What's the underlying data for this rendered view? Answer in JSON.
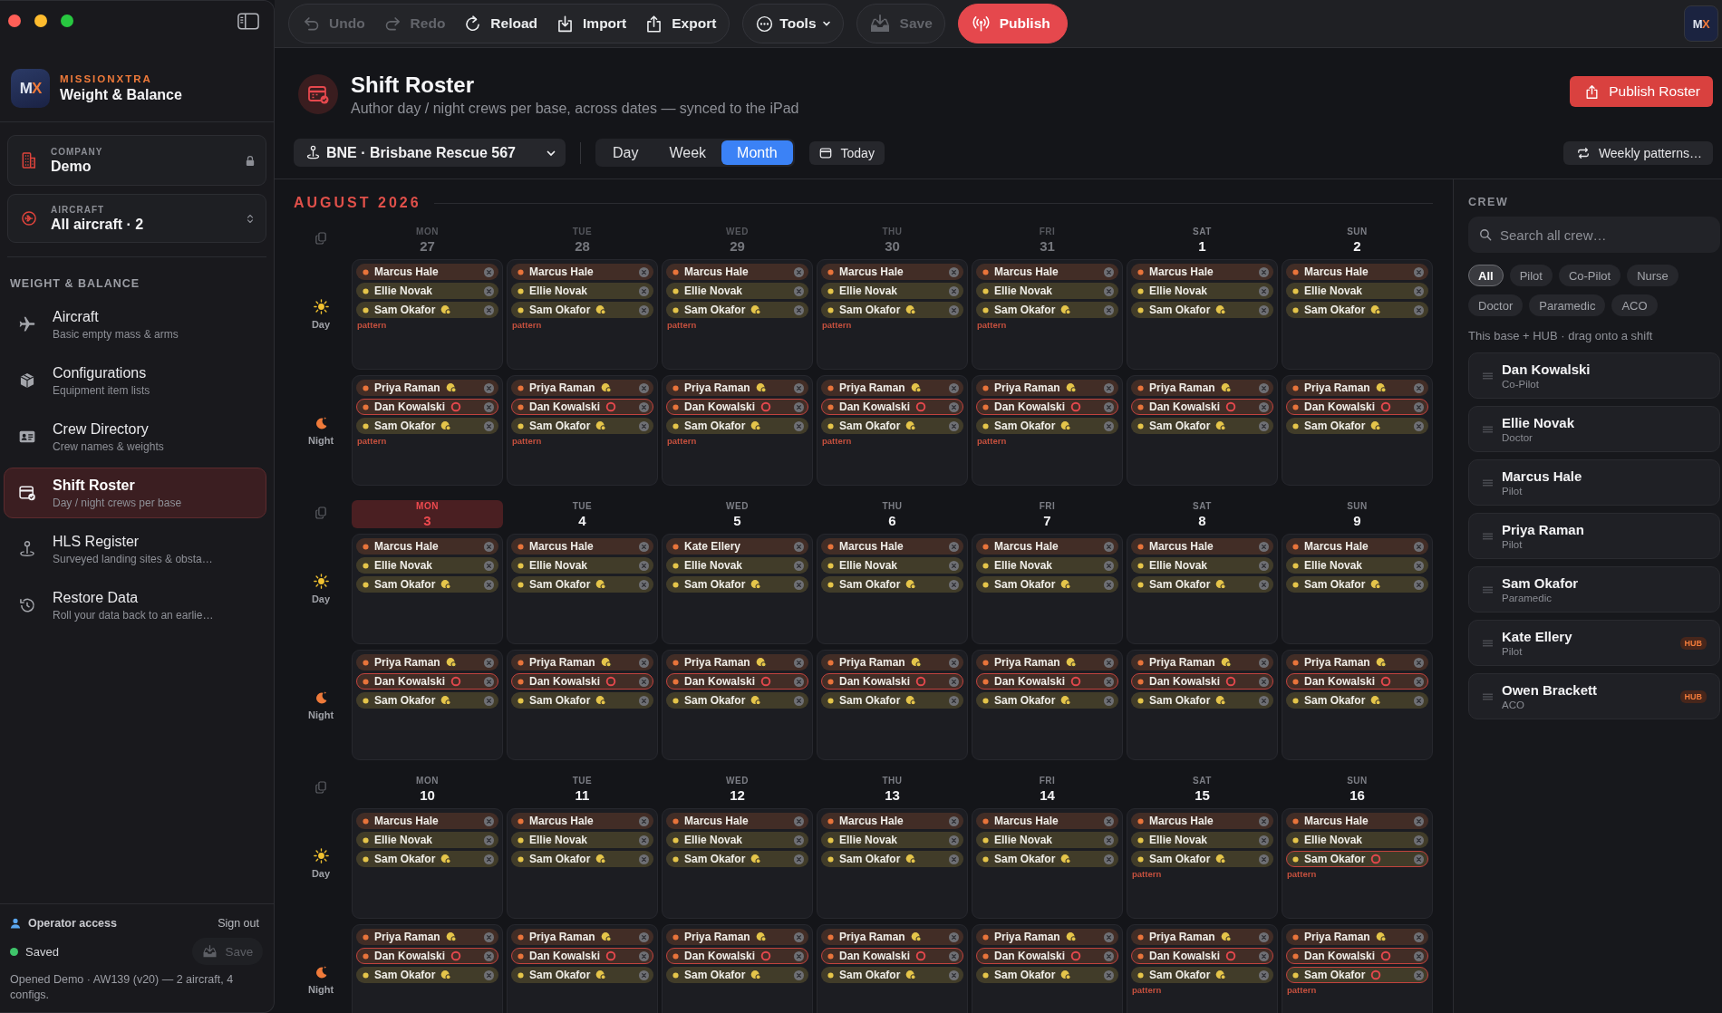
{
  "sidebar": {
    "brand": {
      "logo": "MX",
      "name": "MISSIONXTRA",
      "product": "Weight & Balance"
    },
    "company": {
      "label": "COMPANY",
      "value": "Demo",
      "locked": true
    },
    "aircraft": {
      "label": "AIRCRAFT",
      "value": "All aircraft · 2"
    },
    "section": "WEIGHT & BALANCE",
    "nav": [
      {
        "kind": "plane",
        "title": "Aircraft",
        "subtitle": "Basic empty mass & arms",
        "selected": false
      },
      {
        "kind": "box",
        "title": "Configurations",
        "subtitle": "Equipment item lists",
        "selected": false
      },
      {
        "kind": "card",
        "title": "Crew Directory",
        "subtitle": "Crew names & weights",
        "selected": false
      },
      {
        "kind": "calendar",
        "title": "Shift Roster",
        "subtitle": "Day / night crews per base",
        "selected": true
      },
      {
        "kind": "pin",
        "title": "HLS Register",
        "subtitle": "Surveyed landing sites & obsta…",
        "selected": false
      },
      {
        "kind": "history",
        "title": "Restore Data",
        "subtitle": "Roll your data back to an earlie…",
        "selected": false
      }
    ],
    "footer": {
      "access": "Operator access",
      "sign_out": "Sign out",
      "status": "Saved",
      "save": {
        "label": "Save",
        "disabled": true
      },
      "info": "Opened Demo · AW139 (v20) — 2 aircraft, 4 configs."
    }
  },
  "toolbar": {
    "history": [
      {
        "kind": "undo",
        "label": "Undo",
        "disabled": true
      },
      {
        "kind": "redo",
        "label": "Redo",
        "disabled": true
      },
      {
        "kind": "reload",
        "label": "Reload",
        "disabled": false
      },
      {
        "kind": "import",
        "label": "Import",
        "disabled": false
      },
      {
        "kind": "export",
        "label": "Export",
        "disabled": false
      }
    ],
    "tools": {
      "label": "Tools"
    },
    "save": {
      "label": "Save",
      "disabled": true
    },
    "publish": {
      "label": "Publish"
    },
    "avatar": "MX"
  },
  "header": {
    "title": "Shift Roster",
    "subtitle": "Author day / night crews per base, across dates — synced to the iPad",
    "action": "Publish Roster"
  },
  "controls": {
    "base": "BNE · Brisbane Rescue 567",
    "views": [
      {
        "label": "Day",
        "selected": false
      },
      {
        "label": "Week",
        "selected": false
      },
      {
        "label": "Month",
        "selected": true
      }
    ],
    "today": "Today",
    "patterns": "Weekly patterns…"
  },
  "calendar": {
    "month": "AUGUST 2026",
    "weeks": [
      {
        "days": [
          {
            "dow": "MON",
            "date": "27",
            "outside": true,
            "today": false
          },
          {
            "dow": "TUE",
            "date": "28",
            "outside": true,
            "today": false
          },
          {
            "dow": "WED",
            "date": "29",
            "outside": true,
            "today": false
          },
          {
            "dow": "THU",
            "date": "30",
            "outside": true,
            "today": false
          },
          {
            "dow": "FRI",
            "date": "31",
            "outside": true,
            "today": false
          },
          {
            "dow": "SAT",
            "date": "1",
            "outside": false,
            "today": false
          },
          {
            "dow": "SUN",
            "date": "2",
            "outside": false,
            "today": false
          }
        ],
        "shifts": [
          {
            "kind": "day",
            "label": "Day",
            "cells": [
              {
                "crew": [
                  {
                    "name": "Marcus Hale",
                    "color": "#e8743b",
                    "kind": "plain"
                  },
                  {
                    "name": "Ellie Novak",
                    "color": "#e5c54a",
                    "kind": "plain"
                  },
                  {
                    "name": "Sam Okafor",
                    "color": "#e5c54a",
                    "kind": "badge"
                  }
                ],
                "note": "pattern"
              },
              {
                "crew": [
                  {
                    "name": "Marcus Hale",
                    "color": "#e8743b",
                    "kind": "plain"
                  },
                  {
                    "name": "Ellie Novak",
                    "color": "#e5c54a",
                    "kind": "plain"
                  },
                  {
                    "name": "Sam Okafor",
                    "color": "#e5c54a",
                    "kind": "badge"
                  }
                ],
                "note": "pattern"
              },
              {
                "crew": [
                  {
                    "name": "Marcus Hale",
                    "color": "#e8743b",
                    "kind": "plain"
                  },
                  {
                    "name": "Ellie Novak",
                    "color": "#e5c54a",
                    "kind": "plain"
                  },
                  {
                    "name": "Sam Okafor",
                    "color": "#e5c54a",
                    "kind": "badge"
                  }
                ],
                "note": "pattern"
              },
              {
                "crew": [
                  {
                    "name": "Marcus Hale",
                    "color": "#e8743b",
                    "kind": "plain"
                  },
                  {
                    "name": "Ellie Novak",
                    "color": "#e5c54a",
                    "kind": "plain"
                  },
                  {
                    "name": "Sam Okafor",
                    "color": "#e5c54a",
                    "kind": "badge"
                  }
                ],
                "note": "pattern"
              },
              {
                "crew": [
                  {
                    "name": "Marcus Hale",
                    "color": "#e8743b",
                    "kind": "plain"
                  },
                  {
                    "name": "Ellie Novak",
                    "color": "#e5c54a",
                    "kind": "plain"
                  },
                  {
                    "name": "Sam Okafor",
                    "color": "#e5c54a",
                    "kind": "badge"
                  }
                ],
                "note": "pattern"
              },
              {
                "crew": [
                  {
                    "name": "Marcus Hale",
                    "color": "#e8743b",
                    "kind": "plain"
                  },
                  {
                    "name": "Ellie Novak",
                    "color": "#e5c54a",
                    "kind": "plain"
                  },
                  {
                    "name": "Sam Okafor",
                    "color": "#e5c54a",
                    "kind": "badge"
                  }
                ]
              },
              {
                "crew": [
                  {
                    "name": "Marcus Hale",
                    "color": "#e8743b",
                    "kind": "plain"
                  },
                  {
                    "name": "Ellie Novak",
                    "color": "#e5c54a",
                    "kind": "plain"
                  },
                  {
                    "name": "Sam Okafor",
                    "color": "#e5c54a",
                    "kind": "badge"
                  }
                ]
              }
            ]
          },
          {
            "kind": "night",
            "label": "Night",
            "cells": [
              {
                "crew": [
                  {
                    "name": "Priya Raman",
                    "color": "#e8743b",
                    "kind": "badge"
                  },
                  {
                    "name": "Dan Kowalski",
                    "color": "#e8743b",
                    "kind": "conflict"
                  },
                  {
                    "name": "Sam Okafor",
                    "color": "#e5c54a",
                    "kind": "badge"
                  }
                ],
                "note": "pattern"
              },
              {
                "crew": [
                  {
                    "name": "Priya Raman",
                    "color": "#e8743b",
                    "kind": "badge"
                  },
                  {
                    "name": "Dan Kowalski",
                    "color": "#e8743b",
                    "kind": "conflict"
                  },
                  {
                    "name": "Sam Okafor",
                    "color": "#e5c54a",
                    "kind": "badge"
                  }
                ],
                "note": "pattern"
              },
              {
                "crew": [
                  {
                    "name": "Priya Raman",
                    "color": "#e8743b",
                    "kind": "badge"
                  },
                  {
                    "name": "Dan Kowalski",
                    "color": "#e8743b",
                    "kind": "conflict"
                  },
                  {
                    "name": "Sam Okafor",
                    "color": "#e5c54a",
                    "kind": "badge"
                  }
                ],
                "note": "pattern"
              },
              {
                "crew": [
                  {
                    "name": "Priya Raman",
                    "color": "#e8743b",
                    "kind": "badge"
                  },
                  {
                    "name": "Dan Kowalski",
                    "color": "#e8743b",
                    "kind": "conflict"
                  },
                  {
                    "name": "Sam Okafor",
                    "color": "#e5c54a",
                    "kind": "badge"
                  }
                ],
                "note": "pattern"
              },
              {
                "crew": [
                  {
                    "name": "Priya Raman",
                    "color": "#e8743b",
                    "kind": "badge"
                  },
                  {
                    "name": "Dan Kowalski",
                    "color": "#e8743b",
                    "kind": "conflict"
                  },
                  {
                    "name": "Sam Okafor",
                    "color": "#e5c54a",
                    "kind": "badge"
                  }
                ],
                "note": "pattern"
              },
              {
                "crew": [
                  {
                    "name": "Priya Raman",
                    "color": "#e8743b",
                    "kind": "badge"
                  },
                  {
                    "name": "Dan Kowalski",
                    "color": "#e8743b",
                    "kind": "conflict"
                  },
                  {
                    "name": "Sam Okafor",
                    "color": "#e5c54a",
                    "kind": "badge"
                  }
                ]
              },
              {
                "crew": [
                  {
                    "name": "Priya Raman",
                    "color": "#e8743b",
                    "kind": "badge"
                  },
                  {
                    "name": "Dan Kowalski",
                    "color": "#e8743b",
                    "kind": "conflict"
                  },
                  {
                    "name": "Sam Okafor",
                    "color": "#e5c54a",
                    "kind": "badge"
                  }
                ]
              }
            ]
          }
        ]
      },
      {
        "days": [
          {
            "dow": "MON",
            "date": "3",
            "outside": false,
            "today": true
          },
          {
            "dow": "TUE",
            "date": "4",
            "outside": false,
            "today": false
          },
          {
            "dow": "WED",
            "date": "5",
            "outside": false,
            "today": false
          },
          {
            "dow": "THU",
            "date": "6",
            "outside": false,
            "today": false
          },
          {
            "dow": "FRI",
            "date": "7",
            "outside": false,
            "today": false
          },
          {
            "dow": "SAT",
            "date": "8",
            "outside": false,
            "today": false
          },
          {
            "dow": "SUN",
            "date": "9",
            "outside": false,
            "today": false
          }
        ],
        "shifts": [
          {
            "kind": "day",
            "label": "Day",
            "cells": [
              {
                "crew": [
                  {
                    "name": "Marcus Hale",
                    "color": "#e8743b",
                    "kind": "plain"
                  },
                  {
                    "name": "Ellie Novak",
                    "color": "#e5c54a",
                    "kind": "plain"
                  },
                  {
                    "name": "Sam Okafor",
                    "color": "#e5c54a",
                    "kind": "badge"
                  }
                ]
              },
              {
                "crew": [
                  {
                    "name": "Marcus Hale",
                    "color": "#e8743b",
                    "kind": "plain"
                  },
                  {
                    "name": "Ellie Novak",
                    "color": "#e5c54a",
                    "kind": "plain"
                  },
                  {
                    "name": "Sam Okafor",
                    "color": "#e5c54a",
                    "kind": "badge"
                  }
                ]
              },
              {
                "crew": [
                  {
                    "name": "Kate Ellery",
                    "color": "#e8743b",
                    "kind": "plain"
                  },
                  {
                    "name": "Ellie Novak",
                    "color": "#e5c54a",
                    "kind": "plain"
                  },
                  {
                    "name": "Sam Okafor",
                    "color": "#e5c54a",
                    "kind": "badge"
                  }
                ]
              },
              {
                "crew": [
                  {
                    "name": "Marcus Hale",
                    "color": "#e8743b",
                    "kind": "plain"
                  },
                  {
                    "name": "Ellie Novak",
                    "color": "#e5c54a",
                    "kind": "plain"
                  },
                  {
                    "name": "Sam Okafor",
                    "color": "#e5c54a",
                    "kind": "badge"
                  }
                ]
              },
              {
                "crew": [
                  {
                    "name": "Marcus Hale",
                    "color": "#e8743b",
                    "kind": "plain"
                  },
                  {
                    "name": "Ellie Novak",
                    "color": "#e5c54a",
                    "kind": "plain"
                  },
                  {
                    "name": "Sam Okafor",
                    "color": "#e5c54a",
                    "kind": "badge"
                  }
                ]
              },
              {
                "crew": [
                  {
                    "name": "Marcus Hale",
                    "color": "#e8743b",
                    "kind": "plain"
                  },
                  {
                    "name": "Ellie Novak",
                    "color": "#e5c54a",
                    "kind": "plain"
                  },
                  {
                    "name": "Sam Okafor",
                    "color": "#e5c54a",
                    "kind": "badge"
                  }
                ]
              },
              {
                "crew": [
                  {
                    "name": "Marcus Hale",
                    "color": "#e8743b",
                    "kind": "plain"
                  },
                  {
                    "name": "Ellie Novak",
                    "color": "#e5c54a",
                    "kind": "plain"
                  },
                  {
                    "name": "Sam Okafor",
                    "color": "#e5c54a",
                    "kind": "badge"
                  }
                ]
              }
            ]
          },
          {
            "kind": "night",
            "label": "Night",
            "cells": [
              {
                "crew": [
                  {
                    "name": "Priya Raman",
                    "color": "#e8743b",
                    "kind": "badge"
                  },
                  {
                    "name": "Dan Kowalski",
                    "color": "#e8743b",
                    "kind": "conflict"
                  },
                  {
                    "name": "Sam Okafor",
                    "color": "#e5c54a",
                    "kind": "badge"
                  }
                ]
              },
              {
                "crew": [
                  {
                    "name": "Priya Raman",
                    "color": "#e8743b",
                    "kind": "badge"
                  },
                  {
                    "name": "Dan Kowalski",
                    "color": "#e8743b",
                    "kind": "conflict"
                  },
                  {
                    "name": "Sam Okafor",
                    "color": "#e5c54a",
                    "kind": "badge"
                  }
                ]
              },
              {
                "crew": [
                  {
                    "name": "Priya Raman",
                    "color": "#e8743b",
                    "kind": "badge"
                  },
                  {
                    "name": "Dan Kowalski",
                    "color": "#e8743b",
                    "kind": "conflict"
                  },
                  {
                    "name": "Sam Okafor",
                    "color": "#e5c54a",
                    "kind": "badge"
                  }
                ]
              },
              {
                "crew": [
                  {
                    "name": "Priya Raman",
                    "color": "#e8743b",
                    "kind": "badge"
                  },
                  {
                    "name": "Dan Kowalski",
                    "color": "#e8743b",
                    "kind": "conflict"
                  },
                  {
                    "name": "Sam Okafor",
                    "color": "#e5c54a",
                    "kind": "badge"
                  }
                ]
              },
              {
                "crew": [
                  {
                    "name": "Priya Raman",
                    "color": "#e8743b",
                    "kind": "badge"
                  },
                  {
                    "name": "Dan Kowalski",
                    "color": "#e8743b",
                    "kind": "conflict"
                  },
                  {
                    "name": "Sam Okafor",
                    "color": "#e5c54a",
                    "kind": "badge"
                  }
                ]
              },
              {
                "crew": [
                  {
                    "name": "Priya Raman",
                    "color": "#e8743b",
                    "kind": "badge"
                  },
                  {
                    "name": "Dan Kowalski",
                    "color": "#e8743b",
                    "kind": "conflict"
                  },
                  {
                    "name": "Sam Okafor",
                    "color": "#e5c54a",
                    "kind": "badge"
                  }
                ]
              },
              {
                "crew": [
                  {
                    "name": "Priya Raman",
                    "color": "#e8743b",
                    "kind": "badge"
                  },
                  {
                    "name": "Dan Kowalski",
                    "color": "#e8743b",
                    "kind": "conflict"
                  },
                  {
                    "name": "Sam Okafor",
                    "color": "#e5c54a",
                    "kind": "badge"
                  }
                ]
              }
            ]
          }
        ]
      },
      {
        "days": [
          {
            "dow": "MON",
            "date": "10",
            "outside": false,
            "today": false
          },
          {
            "dow": "TUE",
            "date": "11",
            "outside": false,
            "today": false
          },
          {
            "dow": "WED",
            "date": "12",
            "outside": false,
            "today": false
          },
          {
            "dow": "THU",
            "date": "13",
            "outside": false,
            "today": false
          },
          {
            "dow": "FRI",
            "date": "14",
            "outside": false,
            "today": false
          },
          {
            "dow": "SAT",
            "date": "15",
            "outside": false,
            "today": false
          },
          {
            "dow": "SUN",
            "date": "16",
            "outside": false,
            "today": false
          }
        ],
        "shifts": [
          {
            "kind": "day",
            "label": "Day",
            "cells": [
              {
                "crew": [
                  {
                    "name": "Marcus Hale",
                    "color": "#e8743b",
                    "kind": "plain"
                  },
                  {
                    "name": "Ellie Novak",
                    "color": "#e5c54a",
                    "kind": "plain"
                  },
                  {
                    "name": "Sam Okafor",
                    "color": "#e5c54a",
                    "kind": "badge"
                  }
                ]
              },
              {
                "crew": [
                  {
                    "name": "Marcus Hale",
                    "color": "#e8743b",
                    "kind": "plain"
                  },
                  {
                    "name": "Ellie Novak",
                    "color": "#e5c54a",
                    "kind": "plain"
                  },
                  {
                    "name": "Sam Okafor",
                    "color": "#e5c54a",
                    "kind": "badge"
                  }
                ]
              },
              {
                "crew": [
                  {
                    "name": "Marcus Hale",
                    "color": "#e8743b",
                    "kind": "plain"
                  },
                  {
                    "name": "Ellie Novak",
                    "color": "#e5c54a",
                    "kind": "plain"
                  },
                  {
                    "name": "Sam Okafor",
                    "color": "#e5c54a",
                    "kind": "badge"
                  }
                ]
              },
              {
                "crew": [
                  {
                    "name": "Marcus Hale",
                    "color": "#e8743b",
                    "kind": "plain"
                  },
                  {
                    "name": "Ellie Novak",
                    "color": "#e5c54a",
                    "kind": "plain"
                  },
                  {
                    "name": "Sam Okafor",
                    "color": "#e5c54a",
                    "kind": "badge"
                  }
                ]
              },
              {
                "crew": [
                  {
                    "name": "Marcus Hale",
                    "color": "#e8743b",
                    "kind": "plain"
                  },
                  {
                    "name": "Ellie Novak",
                    "color": "#e5c54a",
                    "kind": "plain"
                  },
                  {
                    "name": "Sam Okafor",
                    "color": "#e5c54a",
                    "kind": "badge"
                  }
                ]
              },
              {
                "crew": [
                  {
                    "name": "Marcus Hale",
                    "color": "#e8743b",
                    "kind": "plain"
                  },
                  {
                    "name": "Ellie Novak",
                    "color": "#e5c54a",
                    "kind": "plain"
                  },
                  {
                    "name": "Sam Okafor",
                    "color": "#e5c54a",
                    "kind": "badge"
                  }
                ],
                "note": "pattern"
              },
              {
                "crew": [
                  {
                    "name": "Marcus Hale",
                    "color": "#e8743b",
                    "kind": "plain"
                  },
                  {
                    "name": "Ellie Novak",
                    "color": "#e5c54a",
                    "kind": "plain"
                  },
                  {
                    "name": "Sam Okafor",
                    "color": "#e5c54a",
                    "kind": "conflict"
                  }
                ],
                "note": "pattern"
              }
            ]
          },
          {
            "kind": "night",
            "label": "Night",
            "cells": [
              {
                "crew": [
                  {
                    "name": "Priya Raman",
                    "color": "#e8743b",
                    "kind": "badge"
                  },
                  {
                    "name": "Dan Kowalski",
                    "color": "#e8743b",
                    "kind": "conflict"
                  },
                  {
                    "name": "Sam Okafor",
                    "color": "#e5c54a",
                    "kind": "badge"
                  }
                ]
              },
              {
                "crew": [
                  {
                    "name": "Priya Raman",
                    "color": "#e8743b",
                    "kind": "badge"
                  },
                  {
                    "name": "Dan Kowalski",
                    "color": "#e8743b",
                    "kind": "conflict"
                  },
                  {
                    "name": "Sam Okafor",
                    "color": "#e5c54a",
                    "kind": "badge"
                  }
                ]
              },
              {
                "crew": [
                  {
                    "name": "Priya Raman",
                    "color": "#e8743b",
                    "kind": "badge"
                  },
                  {
                    "name": "Dan Kowalski",
                    "color": "#e8743b",
                    "kind": "conflict"
                  },
                  {
                    "name": "Sam Okafor",
                    "color": "#e5c54a",
                    "kind": "badge"
                  }
                ]
              },
              {
                "crew": [
                  {
                    "name": "Priya Raman",
                    "color": "#e8743b",
                    "kind": "badge"
                  },
                  {
                    "name": "Dan Kowalski",
                    "color": "#e8743b",
                    "kind": "conflict"
                  },
                  {
                    "name": "Sam Okafor",
                    "color": "#e5c54a",
                    "kind": "badge"
                  }
                ]
              },
              {
                "crew": [
                  {
                    "name": "Priya Raman",
                    "color": "#e8743b",
                    "kind": "badge"
                  },
                  {
                    "name": "Dan Kowalski",
                    "color": "#e8743b",
                    "kind": "conflict"
                  },
                  {
                    "name": "Sam Okafor",
                    "color": "#e5c54a",
                    "kind": "badge"
                  }
                ]
              },
              {
                "crew": [
                  {
                    "name": "Priya Raman",
                    "color": "#e8743b",
                    "kind": "badge"
                  },
                  {
                    "name": "Dan Kowalski",
                    "color": "#e8743b",
                    "kind": "conflict"
                  },
                  {
                    "name": "Sam Okafor",
                    "color": "#e5c54a",
                    "kind": "badge"
                  }
                ],
                "note": "pattern"
              },
              {
                "crew": [
                  {
                    "name": "Priya Raman",
                    "color": "#e8743b",
                    "kind": "badge"
                  },
                  {
                    "name": "Dan Kowalski",
                    "color": "#e8743b",
                    "kind": "conflict"
                  },
                  {
                    "name": "Sam Okafor",
                    "color": "#e5c54a",
                    "kind": "conflict"
                  }
                ],
                "note": "pattern"
              }
            ]
          }
        ]
      }
    ]
  },
  "crew_panel": {
    "title": "CREW",
    "search": {
      "placeholder": "Search all crew…"
    },
    "filters": [
      {
        "label": "All",
        "selected": true
      },
      {
        "label": "Pilot",
        "selected": false
      },
      {
        "label": "Co-Pilot",
        "selected": false
      },
      {
        "label": "Nurse",
        "selected": false
      },
      {
        "label": "Doctor",
        "selected": false
      },
      {
        "label": "Paramedic",
        "selected": false
      },
      {
        "label": "ACO",
        "selected": false
      }
    ],
    "hint": "This base + HUB · drag onto a shift",
    "members": [
      {
        "name": "Dan Kowalski",
        "role": "Co-Pilot"
      },
      {
        "name": "Ellie Novak",
        "role": "Doctor"
      },
      {
        "name": "Marcus Hale",
        "role": "Pilot"
      },
      {
        "name": "Priya Raman",
        "role": "Pilot"
      },
      {
        "name": "Sam Okafor",
        "role": "Paramedic"
      },
      {
        "name": "Kate Ellery",
        "role": "Pilot",
        "tag": "HUB"
      },
      {
        "name": "Owen Brackett",
        "role": "ACO",
        "tag": "HUB"
      }
    ]
  }
}
